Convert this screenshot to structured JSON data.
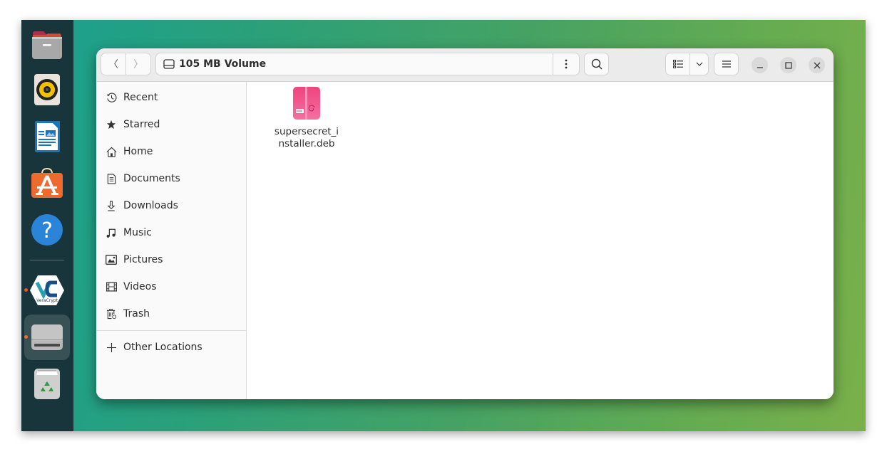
{
  "dock": {
    "items": [
      {
        "name": "Files",
        "icon": "files-icon",
        "running": false
      },
      {
        "name": "Rhythmbox",
        "icon": "rhythmbox-icon",
        "running": false
      },
      {
        "name": "LibreOffice Writer",
        "icon": "writer-icon",
        "running": false
      },
      {
        "name": "Ubuntu Software",
        "icon": "software-icon",
        "running": false
      },
      {
        "name": "Help",
        "icon": "help-icon",
        "running": false
      },
      {
        "name": "VeraCrypt",
        "icon": "veracrypt-icon",
        "running": true,
        "label": "VeraCrypt"
      },
      {
        "name": "105 MB Volume",
        "icon": "drive-icon",
        "running": true,
        "active": true
      },
      {
        "name": "Trash",
        "icon": "trash-icon",
        "running": false
      }
    ],
    "help_glyph": "?"
  },
  "window": {
    "path_label": "105 MB Volume",
    "back_glyph": "〈",
    "forward_glyph": "〉",
    "sidebar": [
      {
        "label": "Recent",
        "icon": "clock-icon"
      },
      {
        "label": "Starred",
        "icon": "star-icon"
      },
      {
        "label": "Home",
        "icon": "home-icon"
      },
      {
        "label": "Documents",
        "icon": "document-icon"
      },
      {
        "label": "Downloads",
        "icon": "download-icon"
      },
      {
        "label": "Music",
        "icon": "music-icon"
      },
      {
        "label": "Pictures",
        "icon": "picture-icon"
      },
      {
        "label": "Videos",
        "icon": "video-icon"
      },
      {
        "label": "Trash",
        "icon": "trash-icon"
      }
    ],
    "other_locations": {
      "label": "Other Locations",
      "glyph": "+"
    },
    "files": [
      {
        "name": "supersecret_installer.deb",
        "icon": "deb-package-icon"
      }
    ]
  },
  "colors": {
    "accent": "#e95420",
    "dock_bg": "#17353a",
    "deb_pink": "#f06292"
  }
}
